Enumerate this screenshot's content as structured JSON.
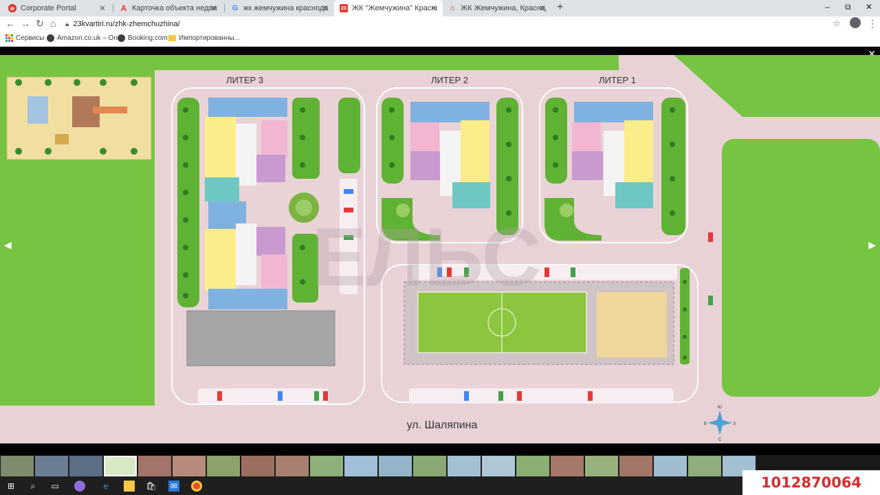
{
  "browser": {
    "tabs": [
      {
        "title": "Corporate Portal",
        "icon": "portal-icon",
        "color": "#d93025"
      },
      {
        "title": "Карточка объекта недвижимос",
        "icon": "a-logo-icon",
        "color": "#e53935"
      },
      {
        "title": "жк жемчужина краснодар плани",
        "icon": "google-icon",
        "color": "#4285f4"
      },
      {
        "title": "ЖК \"Жемчужина\" Краснодар -",
        "icon": "site-23-icon",
        "color": "#e53935",
        "active": true
      },
      {
        "title": "ЖК Жемчужина, Краснодар | Оф",
        "icon": "house-icon",
        "color": "#b71c1c"
      }
    ],
    "new_tab": "+",
    "window_controls": {
      "minimize": "–",
      "maximize": "⧉",
      "close": "✕"
    },
    "url": "23kvartiri.ru/zhk-zhemchuzhina/",
    "bookmarks": [
      {
        "label": "Сервисы",
        "icon": "apps-grid-icon"
      },
      {
        "label": "Amazon.co.uk – On...",
        "icon": "globe-icon"
      },
      {
        "label": "Booking.com",
        "icon": "globe-icon"
      },
      {
        "label": "Импортированны...",
        "icon": "folder-icon"
      }
    ]
  },
  "plan": {
    "labels": {
      "liter3": "ЛИТЕР 3",
      "liter2": "ЛИТЕР 2",
      "liter1": "ЛИТЕР 1"
    },
    "street": "ул. Шаляпина",
    "watermark": "ЕЛЬС",
    "compass": {
      "n": "Ю",
      "w": "В",
      "e": "З",
      "s": "С"
    },
    "colors": {
      "grass": "#76c442",
      "pavement": "#e8cfd2",
      "blue": "#7fb2e0",
      "yellow": "#fbee8a",
      "pink": "#f3b6d2",
      "purple": "#c99ad0",
      "teal": "#6fc7c4",
      "field": "#8cc63f"
    }
  },
  "viewer": {
    "close": "✕",
    "prev": "◀",
    "next": "▶"
  },
  "phone": "1012870064"
}
